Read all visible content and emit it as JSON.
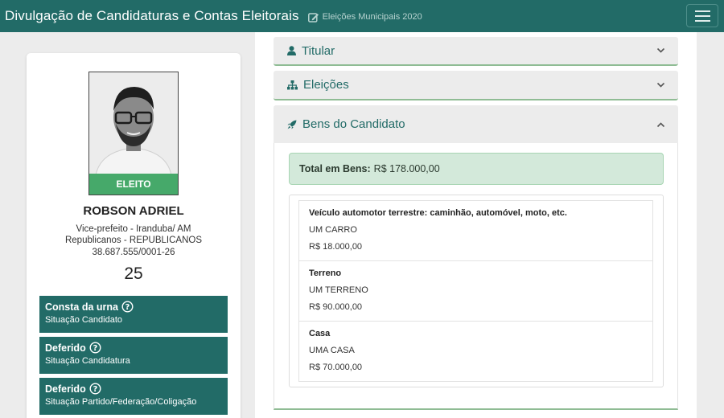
{
  "header": {
    "title": "Divulgação de Candidaturas e Contas Eleitorais",
    "election": "Eleições Municipais 2020",
    "menu_icon": "hamburger-icon"
  },
  "candidate": {
    "badge": "ELEITO",
    "name": "ROBSON ADRIEL",
    "office": "Vice-prefeito - Iranduba/ AM",
    "party": "Republicanos - REPUBLICANOS",
    "cnpj": "38.687.555/0001-26",
    "number": "25"
  },
  "statuses": [
    {
      "title": "Consta da urna",
      "desc": "Situação Candidato"
    },
    {
      "title": "Deferido",
      "desc": "Situação Candidatura"
    },
    {
      "title": "Deferido",
      "desc": "Situação Partido/Federação/Coligação"
    }
  ],
  "accordion": {
    "titular": "Titular",
    "eleicoes": "Eleições",
    "bens": "Bens do Candidato"
  },
  "bens": {
    "total_label": "Total em Bens:",
    "total_value": "R$ 178.000,00",
    "items": [
      {
        "kind": "Veículo automotor terrestre: caminhão, automóvel, moto, etc.",
        "desc": "UM CARRO",
        "value": "R$ 18.000,00"
      },
      {
        "kind": "Terreno",
        "desc": "UM TERRENO",
        "value": "R$ 90.000,00"
      },
      {
        "kind": "Casa",
        "desc": "UMA CASA",
        "value": "R$ 70.000,00"
      }
    ]
  },
  "colors": {
    "navbar": "#226b67",
    "status_box": "#226b67",
    "elected_badge": "#46a96a",
    "total_bg": "#d3e9da",
    "accent_border": "#8fbc94"
  }
}
